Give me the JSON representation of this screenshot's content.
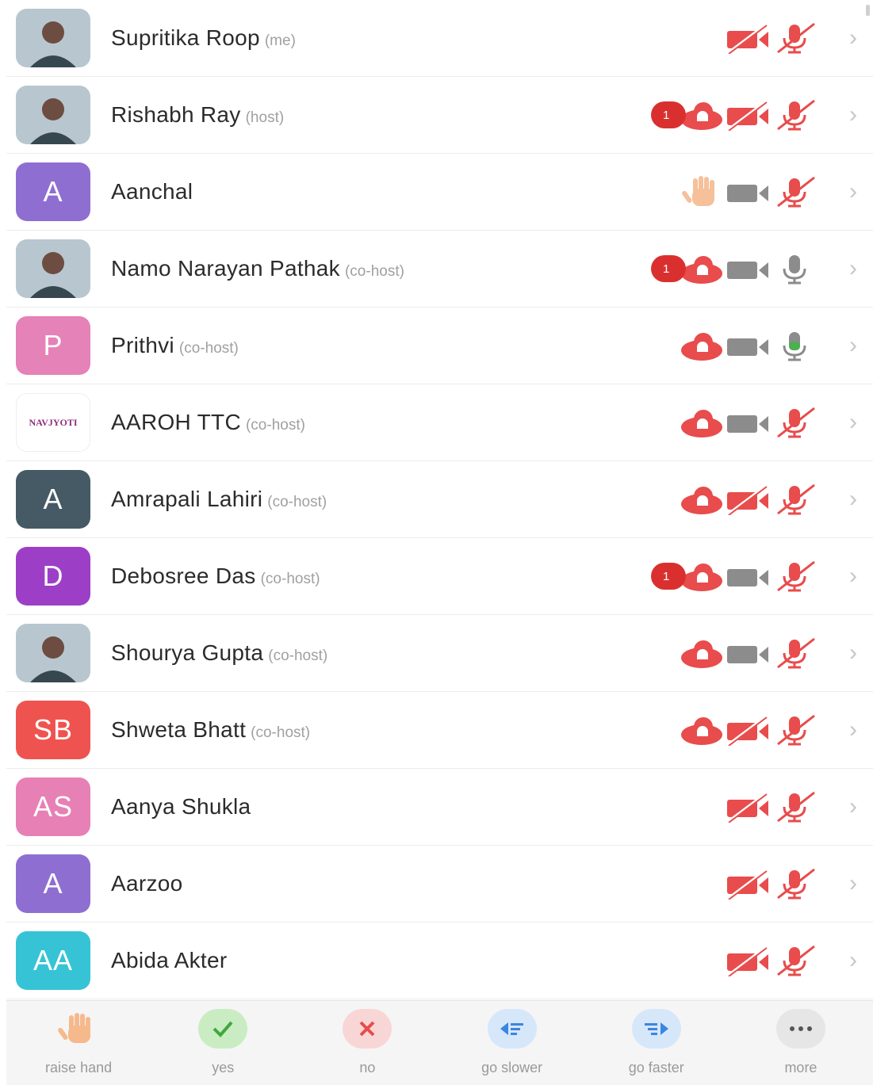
{
  "participants": [
    {
      "name": "Supritika Roop",
      "role": "(me)",
      "avatar": {
        "type": "photo"
      },
      "badge": "",
      "cloud": false,
      "hand": false,
      "camera": "off",
      "mic": "off"
    },
    {
      "name": "Rishabh Ray",
      "role": "(host)",
      "avatar": {
        "type": "photo"
      },
      "badge": "1",
      "cloud": true,
      "hand": false,
      "camera": "off",
      "mic": "off"
    },
    {
      "name": "Aanchal",
      "role": "",
      "avatar": {
        "type": "initials",
        "text": "A",
        "color": "#8e6fd1"
      },
      "badge": "",
      "cloud": false,
      "hand": true,
      "camera": "idle",
      "mic": "off"
    },
    {
      "name": "Namo Narayan Pathak",
      "role": "(co-host)",
      "avatar": {
        "type": "photo"
      },
      "badge": "1",
      "cloud": true,
      "hand": false,
      "camera": "idle",
      "mic": "idle"
    },
    {
      "name": "Prithvi",
      "role": "(co-host)",
      "avatar": {
        "type": "initials",
        "text": "P",
        "color": "#e582b7"
      },
      "badge": "",
      "cloud": true,
      "hand": false,
      "camera": "idle",
      "mic": "on"
    },
    {
      "name": "AAROH TTC",
      "role": "(co-host)",
      "avatar": {
        "type": "logo",
        "text": "NAVJYOTI"
      },
      "badge": "",
      "cloud": true,
      "hand": false,
      "camera": "idle",
      "mic": "off"
    },
    {
      "name": "Amrapali Lahiri",
      "role": "(co-host)",
      "avatar": {
        "type": "initials",
        "text": "A",
        "color": "#455a64"
      },
      "badge": "",
      "cloud": true,
      "hand": false,
      "camera": "off",
      "mic": "off"
    },
    {
      "name": "Debosree Das",
      "role": "(co-host)",
      "avatar": {
        "type": "initials",
        "text": "D",
        "color": "#9c3fc6"
      },
      "badge": "1",
      "cloud": true,
      "hand": false,
      "camera": "idle",
      "mic": "off"
    },
    {
      "name": "Shourya Gupta",
      "role": "(co-host)",
      "avatar": {
        "type": "photo"
      },
      "badge": "",
      "cloud": true,
      "hand": false,
      "camera": "idle",
      "mic": "off"
    },
    {
      "name": "Shweta Bhatt",
      "role": "(co-host)",
      "avatar": {
        "type": "initials",
        "text": "SB",
        "color": "#ef5350"
      },
      "badge": "",
      "cloud": true,
      "hand": false,
      "camera": "off",
      "mic": "off"
    },
    {
      "name": "Aanya Shukla",
      "role": "",
      "avatar": {
        "type": "initials",
        "text": "AS",
        "color": "#e780b5"
      },
      "badge": "",
      "cloud": false,
      "hand": false,
      "camera": "off",
      "mic": "off"
    },
    {
      "name": "Aarzoo",
      "role": "",
      "avatar": {
        "type": "initials",
        "text": "A",
        "color": "#8e6fd1"
      },
      "badge": "",
      "cloud": false,
      "hand": false,
      "camera": "off",
      "mic": "off"
    },
    {
      "name": "Abida Akter",
      "role": "",
      "avatar": {
        "type": "initials",
        "text": "AA",
        "color": "#37c3d6"
      },
      "badge": "",
      "cloud": false,
      "hand": false,
      "camera": "off",
      "mic": "off"
    }
  ],
  "actions": [
    {
      "id": "raise-hand",
      "label": "raise hand",
      "icon": "hand-icon",
      "bg": "",
      "fg": "#f6b98c"
    },
    {
      "id": "yes",
      "label": "yes",
      "icon": "check-icon",
      "bg": "#c9ecc2",
      "fg": "#3fa83a"
    },
    {
      "id": "no",
      "label": "no",
      "icon": "x-icon",
      "bg": "#f9d6d6",
      "fg": "#e84b4b"
    },
    {
      "id": "go-slower",
      "label": "go slower",
      "icon": "rewind-icon",
      "bg": "#d7e7fa",
      "fg": "#3b86e0"
    },
    {
      "id": "go-faster",
      "label": "go faster",
      "icon": "fast-forward-icon",
      "bg": "#d7e7fa",
      "fg": "#3b86e0"
    },
    {
      "id": "more",
      "label": "more",
      "icon": "more-icon",
      "bg": "#e6e6e6",
      "fg": "#555555"
    }
  ],
  "colors": {
    "red": "#e84c4c",
    "gray": "#8c8c8c",
    "green": "#4caf50"
  }
}
